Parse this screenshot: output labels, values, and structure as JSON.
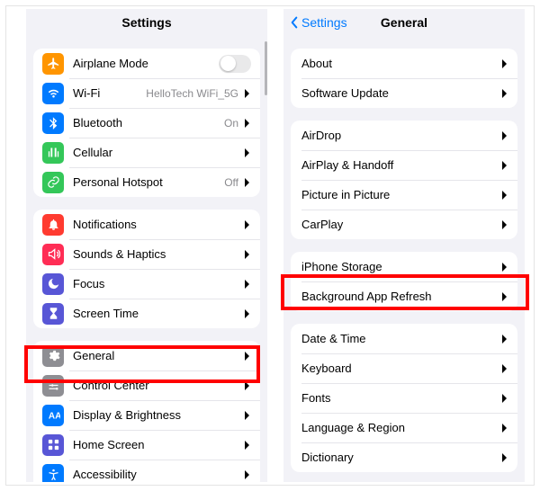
{
  "left": {
    "title": "Settings",
    "g1": {
      "airplane": "Airplane Mode",
      "wifi": "Wi-Fi",
      "wifi_value": "HelloTech WiFi_5G",
      "bluetooth": "Bluetooth",
      "bluetooth_value": "On",
      "cellular": "Cellular",
      "hotspot": "Personal Hotspot",
      "hotspot_value": "Off"
    },
    "g2": {
      "notifications": "Notifications",
      "sounds": "Sounds & Haptics",
      "focus": "Focus",
      "screentime": "Screen Time"
    },
    "g3": {
      "general": "General",
      "control": "Control Center",
      "display": "Display & Brightness",
      "home": "Home Screen",
      "accessibility": "Accessibility"
    }
  },
  "right": {
    "back": "Settings",
    "title": "General",
    "g1": {
      "about": "About",
      "update": "Software Update"
    },
    "g2": {
      "airdrop": "AirDrop",
      "airplay": "AirPlay & Handoff",
      "pip": "Picture in Picture",
      "carplay": "CarPlay"
    },
    "g3": {
      "storage": "iPhone Storage",
      "refresh": "Background App Refresh"
    },
    "g4": {
      "datetime": "Date & Time",
      "keyboard": "Keyboard",
      "fonts": "Fonts",
      "language": "Language & Region",
      "dictionary": "Dictionary"
    }
  },
  "colors": {
    "orange": "#ff9500",
    "blue": "#007aff",
    "green": "#34c759",
    "red": "#ff3b30",
    "pink": "#ff2d55",
    "indigo": "#5856d6",
    "gray": "#8e8e93",
    "blue2": "#0a84ff",
    "airplane": "#ff9500"
  }
}
